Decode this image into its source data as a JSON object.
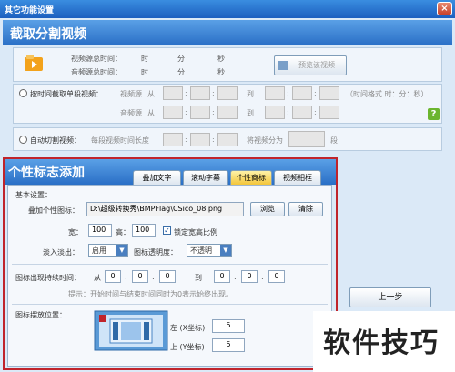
{
  "window": {
    "title": "其它功能设置",
    "close": "×"
  },
  "capture": {
    "title": "截取分割视频",
    "video_total_label": "视频源总时间：",
    "audio_total_label": "音频源总时间：",
    "unit_h": "时",
    "unit_m": "分",
    "unit_s": "秒",
    "preview_button": "预览该视频",
    "by_time_label": "按时间截取单段视频：",
    "video_source": "视频源",
    "audio_source": "音频源",
    "from": "从",
    "to": "到",
    "time_format": "（时间格式 时：分：秒）",
    "auto_split_label": "自动切割视频：",
    "each_length": "每段视频时间长度",
    "split_into": "将视频分为",
    "segments": "段",
    "colon": ":"
  },
  "logo": {
    "title": "个性标志添加",
    "tabs": [
      "叠加文字",
      "滚动字幕",
      "个性商标",
      "视频相框"
    ],
    "active_tab": 2,
    "basic_settings": "基本设置：",
    "overlay_label": "叠加个性图标：",
    "overlay_path": "D:\\超级转换秀\\BMPFlag\\CSico_08.png",
    "browse": "浏览",
    "clear": "清除",
    "width_label": "宽：",
    "width_value": "100",
    "height_label": "高：",
    "height_value": "100",
    "lock_ratio": "锁定宽高比例",
    "fade_label": "淡入淡出：",
    "fade_value": "启用",
    "opacity_label": "图标透明度：",
    "opacity_value": "不透明",
    "appear_time_label": "图标出现持续时间：",
    "from": "从",
    "to": "到",
    "time_from": [
      "0",
      "0",
      "0"
    ],
    "time_to": [
      "0",
      "0",
      "0"
    ],
    "hint": "提示：开始时间与结束时间同时为0表示始终出现。",
    "position_label": "图标摆放位置：",
    "left_label": "左 (X坐标)",
    "left_value": "5",
    "top_label": "上 (Y坐标)",
    "top_value": "5"
  },
  "side": {
    "prev_button": "上一步"
  },
  "watermark": "软件技巧",
  "colors": {
    "accent": "#2a6fc6",
    "highlight_border": "#c0242b",
    "help_icon": "#6bb52e"
  }
}
